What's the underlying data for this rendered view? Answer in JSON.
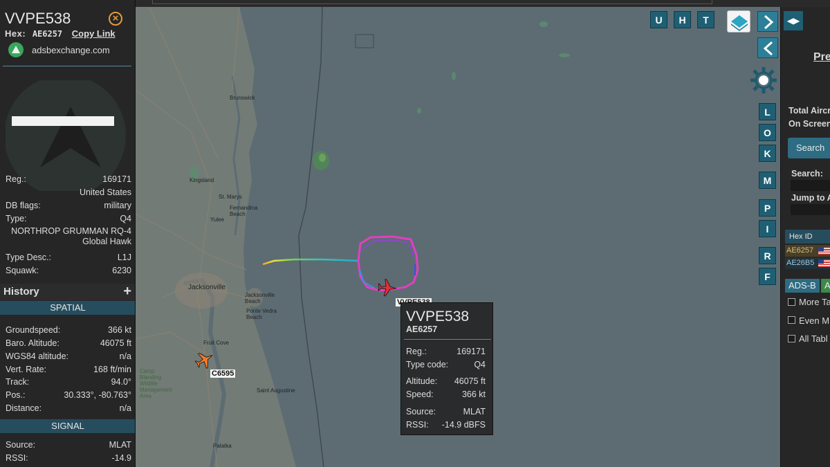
{
  "aircraft": {
    "callsign": "VVPE538",
    "hex_label": "Hex:",
    "hex": "AE6257",
    "copy_link": "Copy Link",
    "site": "adsbexchange.com",
    "reg_label": "Reg.:",
    "reg": "169171",
    "country": "United States",
    "dbflags_label": "DB flags:",
    "dbflags": "military",
    "type_label": "Type:",
    "type": "Q4",
    "type_full": "NORTHROP GRUMMAN RQ-4 Global Hawk",
    "typedesc_label": "Type Desc.:",
    "typedesc": "L1J",
    "squawk_label": "Squawk:",
    "squawk": "6230"
  },
  "history": {
    "title": "History",
    "plus": "+"
  },
  "spatial": {
    "header": "SPATIAL",
    "groundspeed_label": "Groundspeed:",
    "groundspeed": "366 kt",
    "baro_label": "Baro. Altitude:",
    "baro": "46075 ft",
    "wgs_label": "WGS84 altitude:",
    "wgs": "n/a",
    "vrate_label": "Vert. Rate:",
    "vrate": "168 ft/min",
    "track_label": "Track:",
    "track": "94.0°",
    "pos_label": "Pos.:",
    "pos": "30.333°, -80.763°",
    "distance_label": "Distance:",
    "distance": "n/a"
  },
  "signal": {
    "header": "SIGNAL",
    "source_label": "Source:",
    "source": "MLAT",
    "rssi_label": "RSSI:",
    "rssi": "-14.9"
  },
  "map": {
    "top_buttons": [
      "U",
      "H",
      "T"
    ],
    "side_buttons": [
      "L",
      "O",
      "K",
      "M",
      "P",
      "I",
      "R",
      "F"
    ],
    "places": {
      "brunswick": "Brunswick",
      "kingsland": "Kingsland",
      "stmarys": "St. Marys",
      "fernandina": "Fernandina Beach",
      "yulee": "Yulee",
      "jacksonville": "Jacksonville",
      "jaxbeach": "Jacksonville Beach",
      "pontevedra": "Ponte Vedra Beach",
      "fruitcove": "Fruit Cove",
      "staugustine": "Saint Augustine",
      "palatka": "Palatka",
      "campblanding": "Camp Blanding Wildlife Management Area"
    },
    "aircraft_label_main": "VVPE538",
    "aircraft_label_other": "C6595"
  },
  "tooltip": {
    "callsign": "VVPE538",
    "hex": "AE6257",
    "reg_label": "Reg.:",
    "reg": "169171",
    "typecode_label": "Type code:",
    "typecode": "Q4",
    "altitude_label": "Altitude:",
    "altitude": "46075 ft",
    "speed_label": "Speed:",
    "speed": "366 kt",
    "source_label": "Source:",
    "source": "MLAT",
    "rssi_label": "RSSI:",
    "rssi": "-14.9 dBFS"
  },
  "right": {
    "link": "Pre",
    "total_aircraft": "Total Aircr",
    "on_screen": "On Screen",
    "search_button": "Search",
    "search_label": "Search:",
    "jump_label": "Jump to A",
    "table_header": "Hex ID",
    "rows": [
      "AE6257",
      "AE26B5"
    ],
    "tab_adsb": "ADS-B",
    "tab_a": "A",
    "checkbox_1": "More Ta",
    "checkbox_2": "Even M",
    "checkbox_3": "All Tabl"
  },
  "colors": {
    "panel": "#262626",
    "accent": "#264d5e",
    "ocean": "#5d6c73",
    "track_main": "#e040c0",
    "aircraft_selected": "#e0303a",
    "aircraft_other": "#f07a2a"
  }
}
